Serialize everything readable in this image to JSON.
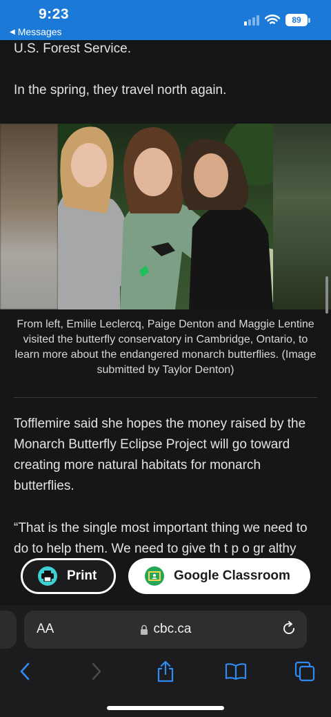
{
  "status_bar": {
    "time": "9:23",
    "back_label": "Messages",
    "battery": "89",
    "accent_color": "#1b79d8"
  },
  "article": {
    "para_top_1": "U.S. Forest Service.",
    "para_top_2": "In the spring, they travel north again.",
    "image_alt": "Three girls holding butterflies",
    "caption": "From left, Emilie Leclercq, Paige Denton and Maggie Lentine visited the butterfly conservatory in Cambridge, Ontario, to learn more about the endangered monarch butterflies. (Image submitted by Taylor Denton)",
    "para_3": "Tofflemire said she hopes the money raised by the Monarch Butterfly Eclipse Project will go toward creating more natural habitats for monarch butterflies.",
    "para_4": "“That is the single most important thing we need to do to help them. We need to give th                              t p                                  o gr                      althy"
  },
  "share": {
    "print_label": "Print",
    "print_icon": "printer-icon",
    "classroom_label": "Google Classroom",
    "classroom_icon": "google-classroom-icon"
  },
  "browser": {
    "text_size_label": "AA",
    "url": "cbc.ca",
    "icons": [
      "back-icon",
      "forward-icon",
      "share-icon",
      "bookmarks-icon",
      "tabs-icon",
      "reload-icon",
      "lock-icon"
    ]
  }
}
